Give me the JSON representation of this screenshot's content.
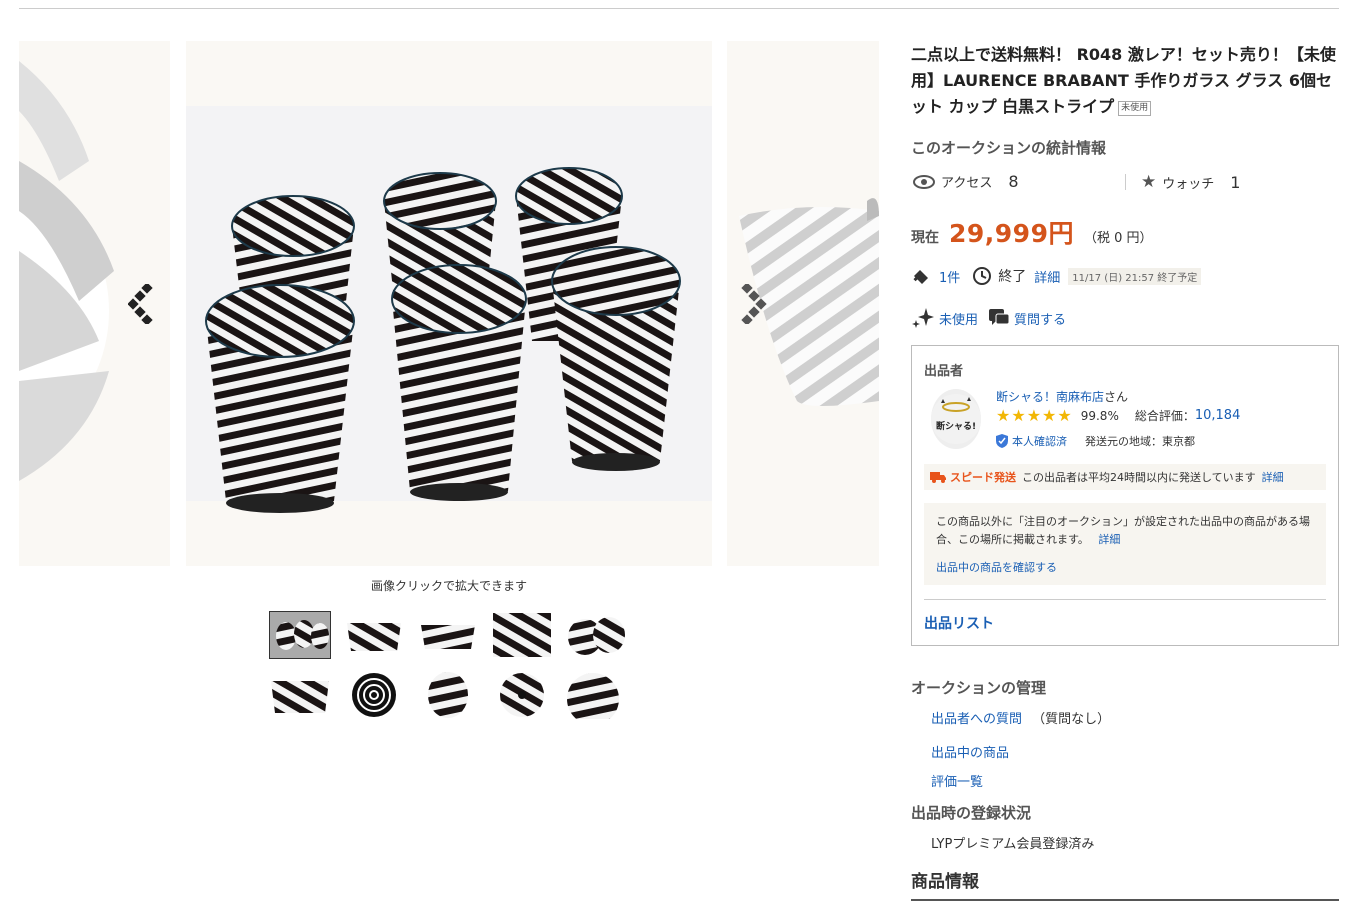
{
  "gallery": {
    "zoom_note": "画像クリックで拡大できます",
    "thumbnail_count": 10,
    "selected_thumbnail": 1
  },
  "listing": {
    "title": "二点以上で送料無料！ R048 激レア！セット売り！【未使用】LAURENCE BRABANT 手作りガラス グラス 6個セット カップ 白黒ストライプ",
    "condition_badge": "未使用"
  },
  "stats": {
    "heading": "このオークションの統計情報",
    "access_label": "アクセス",
    "access_count": "8",
    "watch_label": "ウォッチ",
    "watch_count": "1"
  },
  "price": {
    "label": "現在",
    "amount": "29,999円",
    "tax": "（税 0 円）"
  },
  "bid_info": {
    "bids": "1件",
    "end_label": "終了",
    "detail_link": "詳細",
    "end_date": "11/17 (日) 21:57 終了予定"
  },
  "condition_info": {
    "condition": "未使用",
    "question_link": "質問する"
  },
  "seller": {
    "section_label": "出品者",
    "avatar_text": "断シャる!",
    "name": "断シャる！南麻布店",
    "name_suffix": "さん",
    "rating_percent": "99.8%",
    "total_label": "総合評価：",
    "total_value": "10,184",
    "verified": "本人確認済",
    "ship_from": "発送元の地域：東京都",
    "speed_label": "スピード発送",
    "speed_text": "この出品者は平均24時間以内に発送しています",
    "speed_link": "詳細",
    "notice_text": "この商品以外に「注目のオークション」が設定された出品中の商品がある場合、この場所に掲載されます。",
    "notice_link": "詳細",
    "check_link": "出品中の商品を確認する",
    "list_link": "出品リスト"
  },
  "management": {
    "heading": "オークションの管理",
    "question_link": "出品者への質問",
    "question_status": "（質問なし）",
    "items_link": "出品中の商品",
    "ratings_link": "評価一覧"
  },
  "registration": {
    "heading": "出品時の登録状況",
    "status": "LYPプレミアム会員登録済み"
  },
  "product_info": {
    "heading": "商品情報"
  },
  "colors": {
    "price": "#d4541b",
    "link": "#1a5fb4",
    "star": "#f2b705",
    "speed": "#e8541b"
  }
}
